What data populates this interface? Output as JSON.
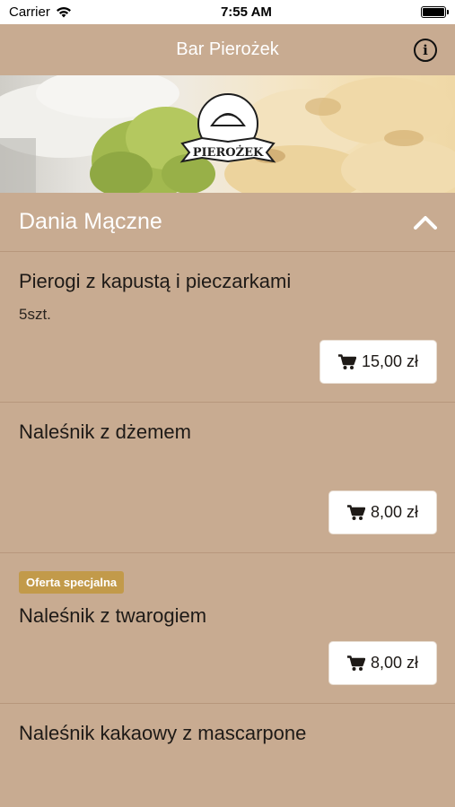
{
  "status_bar": {
    "carrier": "Carrier",
    "time": "7:55 AM"
  },
  "nav": {
    "title": "Bar Pierożek",
    "info_icon": "info-icon"
  },
  "hero": {
    "logo_text": "PIEROŻEK"
  },
  "section": {
    "title": "Dania Mączne",
    "icon": "chevron-up-icon"
  },
  "items": [
    {
      "name": "Pierogi z kapustą i pieczarkami",
      "description": "5szt.",
      "price": "15,00 zł",
      "badge": ""
    },
    {
      "name": "Naleśnik z dżemem",
      "description": "",
      "price": "8,00 zł",
      "badge": ""
    },
    {
      "name": "Naleśnik z twarogiem",
      "description": "",
      "price": "8,00 zł",
      "badge": "Oferta specjalna"
    },
    {
      "name": "Naleśnik kakaowy z mascarpone",
      "description": "",
      "price": "",
      "badge": ""
    }
  ],
  "colors": {
    "background": "#c8ab91",
    "badge": "#c29a4a",
    "header_text": "#ffffff"
  }
}
